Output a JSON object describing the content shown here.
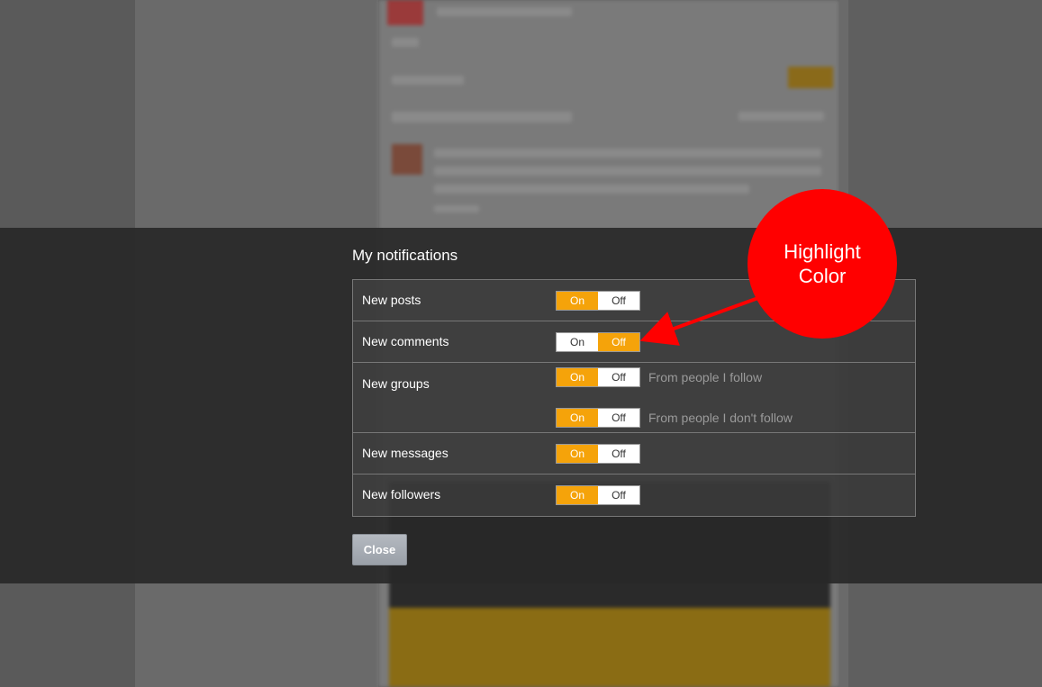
{
  "dialog": {
    "title": "My notifications",
    "rows": [
      {
        "label": "New posts",
        "toggles": [
          {
            "on": "On",
            "off": "Off",
            "state": "on",
            "description": ""
          }
        ]
      },
      {
        "label": "New comments",
        "toggles": [
          {
            "on": "On",
            "off": "Off",
            "state": "off",
            "description": ""
          }
        ]
      },
      {
        "label": "New groups",
        "toggles": [
          {
            "on": "On",
            "off": "Off",
            "state": "on",
            "description": "From people I follow"
          },
          {
            "on": "On",
            "off": "Off",
            "state": "on",
            "description": "From people I don't follow"
          }
        ]
      },
      {
        "label": "New messages",
        "toggles": [
          {
            "on": "On",
            "off": "Off",
            "state": "on",
            "description": ""
          }
        ]
      },
      {
        "label": "New followers",
        "toggles": [
          {
            "on": "On",
            "off": "Off",
            "state": "on",
            "description": ""
          }
        ]
      }
    ],
    "close_label": "Close"
  },
  "annotation": {
    "callout_line1": "Highlight",
    "callout_line2": "Color"
  },
  "colors": {
    "highlight": "#f5a30a",
    "callout": "#ff0000",
    "overlay": "#2f2f2f"
  }
}
